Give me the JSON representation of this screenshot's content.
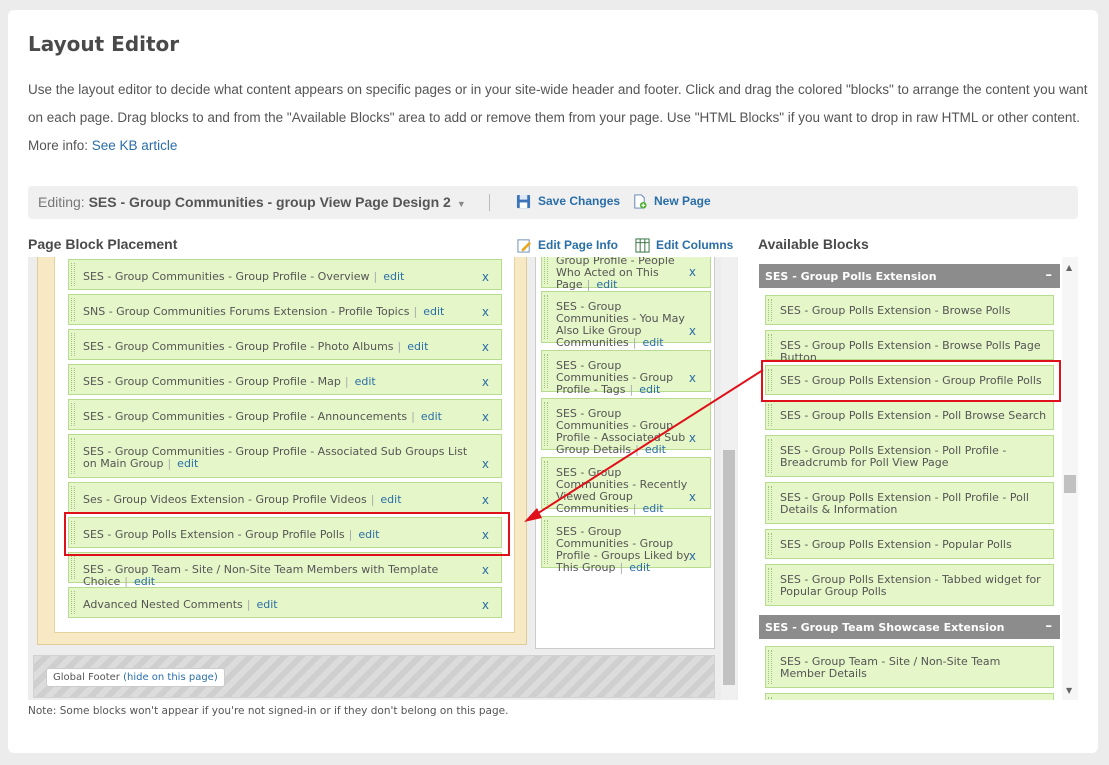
{
  "title": "Layout Editor",
  "description": {
    "text": "Use the layout editor to decide what content appears on specific pages or in your site-wide header and footer. Click and drag the colored \"blocks\" to arrange the content you want on each page. Drag blocks to and from the \"Available Blocks\" area to add or remove them from your page. Use \"HTML Blocks\" if you want to drop in raw HTML or other content. More info: ",
    "link": "See KB article"
  },
  "toolbar": {
    "editing_label": "Editing:",
    "page_name": "SES - Group Communities - group View Page Design 2",
    "save_label": "Save Changes",
    "new_page_label": "New Page"
  },
  "placement": {
    "heading": "Page Block Placement",
    "edit_page_info": "Edit Page Info",
    "edit_columns": "Edit Columns"
  },
  "main_blocks": [
    {
      "label": "SES - Group Communities - Group Profile - Overview",
      "edit": "edit",
      "x": "x"
    },
    {
      "label": "SNS - Group Communities Forums Extension - Profile Topics",
      "edit": "edit",
      "x": "x"
    },
    {
      "label": "SES - Group Communities - Group Profile - Photo Albums",
      "edit": "edit",
      "x": "x"
    },
    {
      "label": "SES - Group Communities - Group Profile - Map",
      "edit": "edit",
      "x": "x"
    },
    {
      "label": "SES - Group Communities - Group Profile - Announcements",
      "edit": "edit",
      "x": "x"
    },
    {
      "label": "SES - Group Communities - Group Profile - Associated Sub Groups List on Main Group",
      "edit": "edit",
      "x": "x"
    },
    {
      "label": "Ses - Group Videos Extension - Group Profile Videos",
      "edit": "edit",
      "x": "x"
    },
    {
      "label": "SES - Group Polls Extension - Group Profile Polls",
      "edit": "edit",
      "x": "x"
    },
    {
      "label": "SES - Group Team - Site / Non-Site Team Members with Template Choice",
      "edit": "edit",
      "x": "x"
    },
    {
      "label": "Advanced Nested Comments",
      "edit": "edit",
      "x": "x"
    }
  ],
  "side_blocks": [
    {
      "label": "Group Profile - People Who Acted on This Page",
      "edit": "edit",
      "x": "x"
    },
    {
      "label": "SES - Group Communities - You May Also Like Group Communities",
      "edit": "edit",
      "x": "x"
    },
    {
      "label": "SES - Group Communities - Group Profile - Tags",
      "edit": "edit",
      "x": "x"
    },
    {
      "label": "SES - Group Communities - Group Profile - Associated Sub Group Details",
      "edit": "edit",
      "x": "x"
    },
    {
      "label": "SES - Group Communities - Recently Viewed Group Communities",
      "edit": "edit",
      "x": "x"
    },
    {
      "label": "SES - Group Communities - Group Profile - Groups Liked by This Group",
      "edit": "edit",
      "x": "x"
    }
  ],
  "footer": {
    "label": "Global Footer",
    "link": "(hide on this page)"
  },
  "note": "Note: Some blocks won't appear if you're not signed-in or if they don't belong on this page.",
  "available": {
    "heading": "Available Blocks",
    "categories": [
      {
        "name": "SES - Group Polls Extension",
        "toggle": "–",
        "blocks": [
          "SES - Group Polls Extension - Browse Polls",
          "SES - Group Polls Extension - Browse Polls Page Button",
          "SES - Group Polls Extension - Group Profile Polls",
          "SES - Group Polls Extension - Poll Browse Search",
          "SES - Group Polls Extension - Poll Profile - Breadcrumb for Poll View Page",
          "SES - Group Polls Extension - Poll Profile - Poll Details & Information",
          "SES - Group Polls Extension - Popular Polls",
          "SES - Group Polls Extension - Tabbed widget for Popular Group Polls"
        ]
      },
      {
        "name": "SES - Group Team Showcase Extension",
        "toggle": "–",
        "blocks": [
          "SES - Group Team - Site / Non-Site Team Member Details"
        ]
      }
    ]
  },
  "colors": {
    "link": "#2a6ea8",
    "block_bg": "#e5f6c8",
    "highlight": "#e0101a",
    "category_bg": "#8c8c8c"
  }
}
